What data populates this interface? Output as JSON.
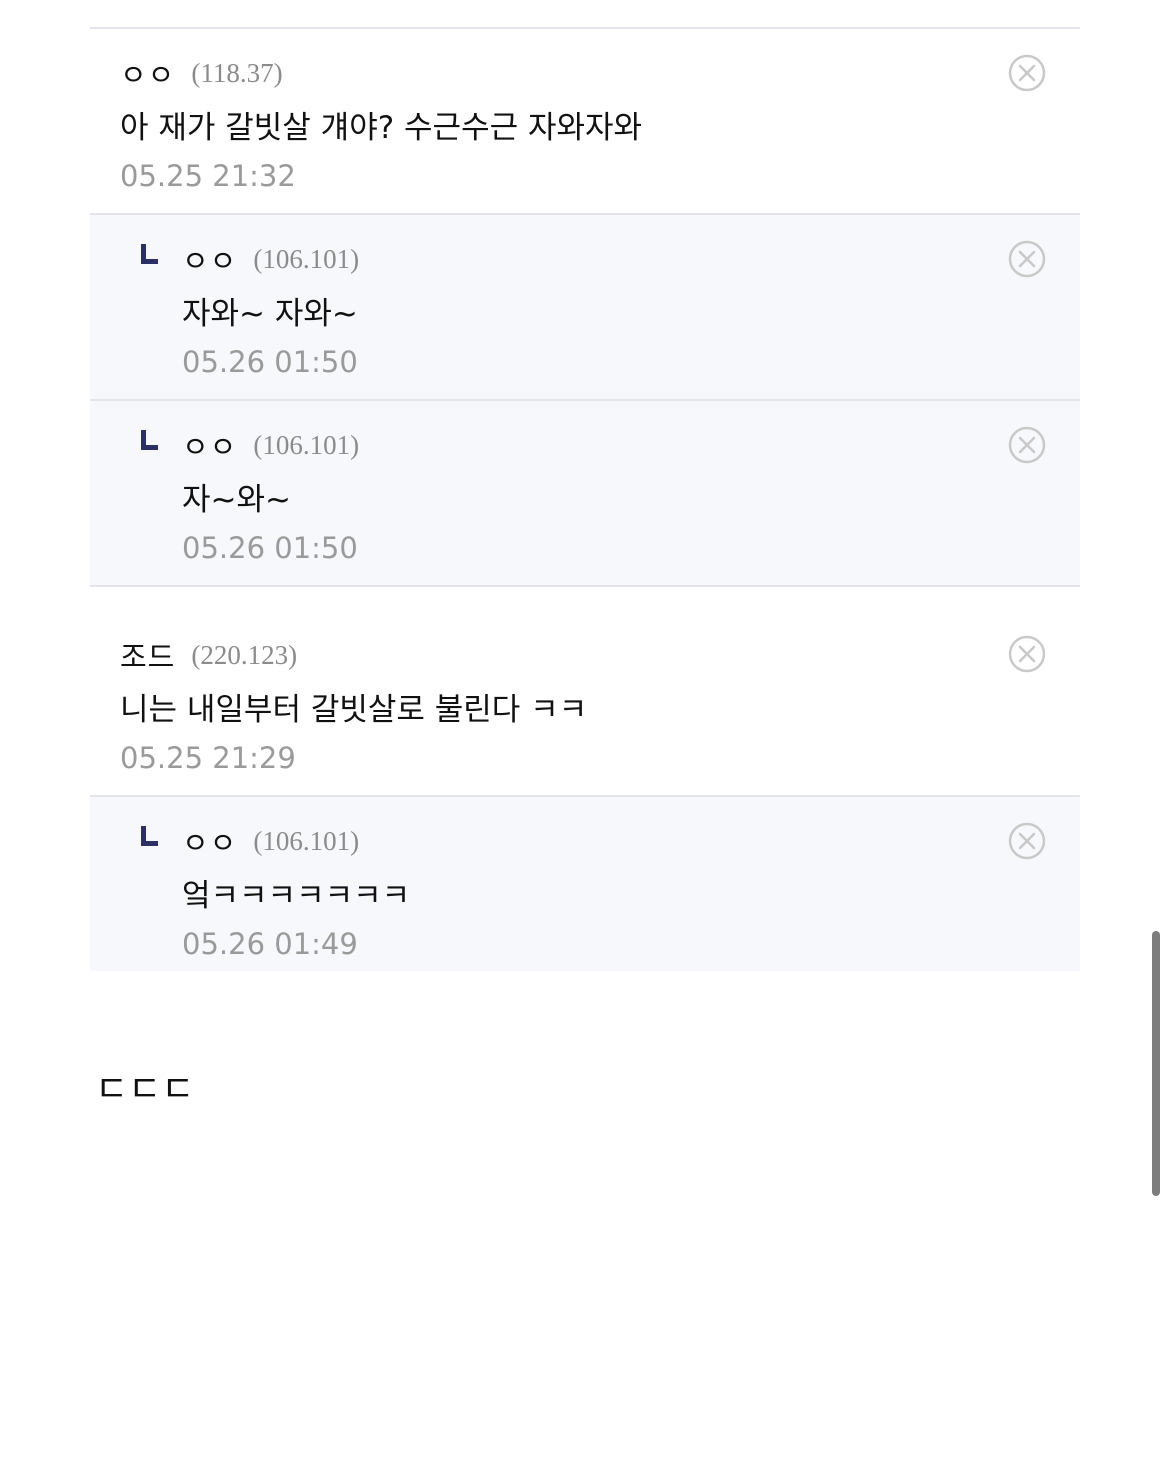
{
  "comments": [
    {
      "nick": "ㅇㅇ",
      "ip": "(118.37)",
      "text": "아 재가 갈빗살 걔야? 수근수근 자와자와",
      "date": "05.25 21:32"
    },
    {
      "nick": "ㅇㅇ",
      "ip": "(106.101)",
      "text": "자와~ 자와~",
      "date": "05.26 01:50"
    },
    {
      "nick": "ㅇㅇ",
      "ip": "(106.101)",
      "text": "자~와~",
      "date": "05.26 01:50"
    },
    {
      "nick": "조드",
      "ip": "(220.123)",
      "text": "니는 내일부터 갈빗살로 불린다 ㅋㅋ",
      "date": "05.25 21:29"
    },
    {
      "nick": "ㅇㅇ",
      "ip": "(106.101)",
      "text": "엌ㅋㅋㅋㅋㅋㅋㅋ",
      "date": "05.26 01:49"
    }
  ],
  "post": {
    "text": "ㄷㄷㄷ"
  },
  "icons": {
    "delete": "close-circle-icon",
    "reply": "reply-arrow-icon"
  },
  "colors": {
    "reply_background": "#f7f8fb",
    "divider": "#e4e5ea",
    "reply_mark": "#2c2f63",
    "meta_gray": "#8b8b8b"
  }
}
